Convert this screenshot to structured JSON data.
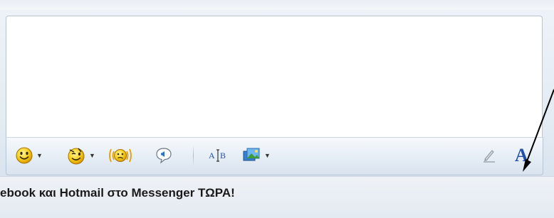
{
  "toolbar": {
    "items": [
      {
        "icon": "emoticon-smile-icon",
        "has_dropdown": true
      },
      {
        "icon": "wink-icon",
        "has_dropdown": true
      },
      {
        "icon": "nudge-icon",
        "has_dropdown": false
      },
      {
        "icon": "voice-clip-icon",
        "has_dropdown": false
      },
      {
        "icon": "font-format-icon",
        "has_dropdown": false
      },
      {
        "icon": "background-image-icon",
        "has_dropdown": true
      },
      {
        "icon": "handwriting-pen-icon",
        "has_dropdown": false
      },
      {
        "icon": "text-style-icon",
        "has_dropdown": false
      }
    ],
    "font_label": "A",
    "font_glyph_left": "A",
    "font_glyph_right": "B"
  },
  "status": {
    "message": "ebook και Hotmail στο Messenger ΤΩΡΑ!"
  },
  "colors": {
    "accent": "#1f4fa8",
    "toolbar_bg": "#e5edf5",
    "border": "#b6c6d7"
  }
}
